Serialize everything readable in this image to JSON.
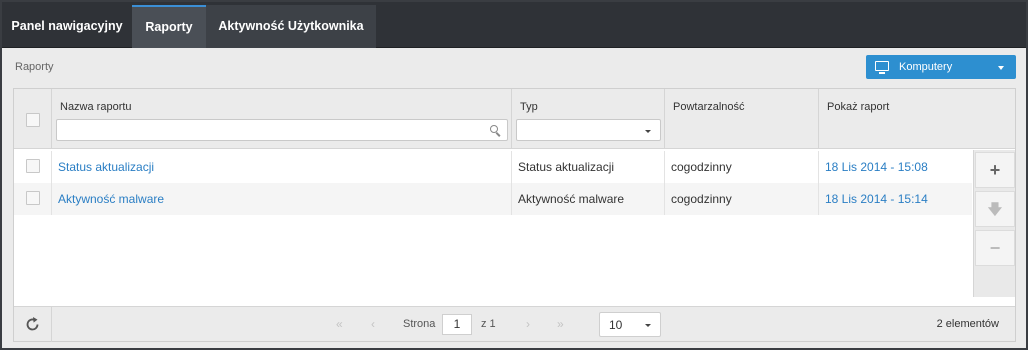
{
  "nav": {
    "tabs": [
      {
        "label": "Panel nawigacyjny"
      },
      {
        "label": "Raporty"
      },
      {
        "label": "Aktywność Użytkownika"
      }
    ]
  },
  "breadcrumb": "Raporty",
  "scope": {
    "label": "Komputery",
    "icon": "monitor-icon"
  },
  "table": {
    "columns": [
      "Nazwa raportu",
      "Typ",
      "Powtarzalność",
      "Pokaż raport"
    ],
    "rows": [
      {
        "name": "Status aktualizacji",
        "type": "Status aktualizacji",
        "recurrence": "cogodzinny",
        "show": "18 Lis 2014 - 15:08"
      },
      {
        "name": "Aktywność malware",
        "type": "Aktywność malware",
        "recurrence": "cogodzinny",
        "show": "18 Lis 2014 - 15:14"
      }
    ]
  },
  "side_actions": {
    "add": "+",
    "download": "🡇",
    "remove": "−"
  },
  "pagination": {
    "page_label": "Strona",
    "page": "1",
    "of_label": "z 1",
    "first": "«",
    "prev": "‹",
    "next": "›",
    "last": "»",
    "per_page": "10",
    "count": "2 elementów"
  },
  "colors": {
    "accent": "#2d8fd0",
    "link": "#2a7ec4",
    "nav_bg": "#2f3237"
  }
}
